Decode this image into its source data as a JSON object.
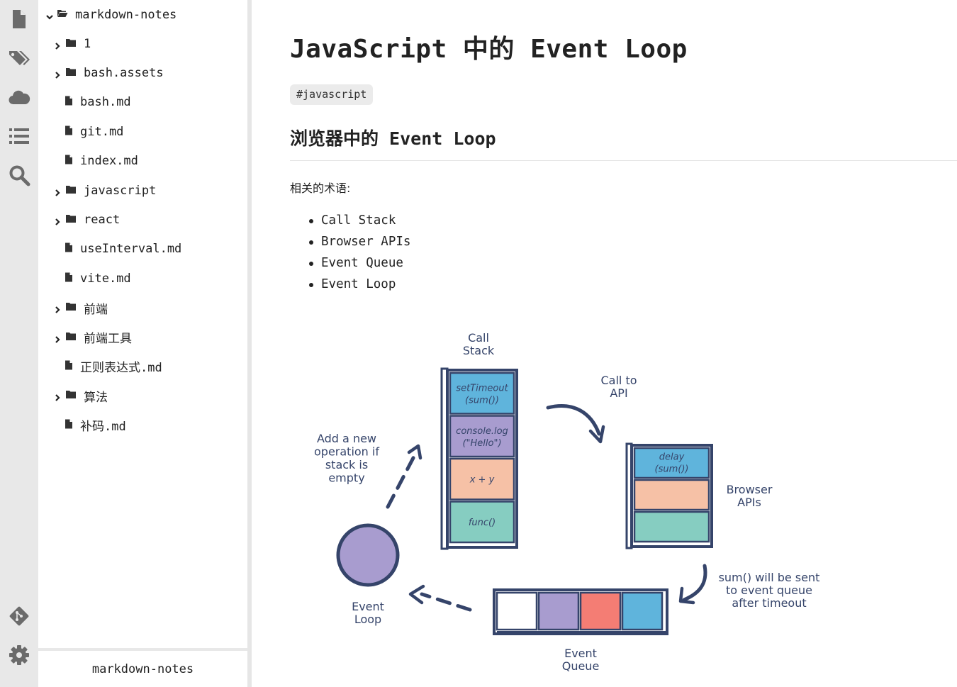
{
  "activity_bar": {
    "items": [
      {
        "name": "file-icon"
      },
      {
        "name": "tags-icon"
      },
      {
        "name": "cloud-icon"
      },
      {
        "name": "list-icon"
      },
      {
        "name": "search-icon"
      },
      {
        "name": "git-icon"
      },
      {
        "name": "gear-icon"
      }
    ]
  },
  "sidebar": {
    "root": "markdown-notes",
    "items": [
      {
        "label": "1",
        "type": "folder"
      },
      {
        "label": "bash.assets",
        "type": "folder"
      },
      {
        "label": "bash.md",
        "type": "file"
      },
      {
        "label": "git.md",
        "type": "file"
      },
      {
        "label": "index.md",
        "type": "file"
      },
      {
        "label": "javascript",
        "type": "folder"
      },
      {
        "label": "react",
        "type": "folder"
      },
      {
        "label": "useInterval.md",
        "type": "file"
      },
      {
        "label": "vite.md",
        "type": "file"
      },
      {
        "label": "前端",
        "type": "folder"
      },
      {
        "label": "前端工具",
        "type": "folder"
      },
      {
        "label": "正则表达式.md",
        "type": "file"
      },
      {
        "label": "算法",
        "type": "folder"
      },
      {
        "label": "补码.md",
        "type": "file"
      }
    ],
    "footer": "markdown-notes"
  },
  "document": {
    "title": "JavaScript 中的 Event Loop",
    "tag": "#javascript",
    "heading": "浏览器中的 Event Loop",
    "paragraph": "相关的术语:",
    "terms": [
      "Call Stack",
      "Browser APIs",
      "Event Queue",
      "Event Loop"
    ]
  },
  "diagram": {
    "call_stack_label": [
      "Call",
      "Stack"
    ],
    "call_stack_items": [
      {
        "lines": [
          "setTimeout",
          "(sum())"
        ],
        "color": "#5fb4dc"
      },
      {
        "lines": [
          "console.log",
          "(\"Hello\")"
        ],
        "color": "#a89ccf"
      },
      {
        "lines": [
          "x + y"
        ],
        "color": "#f6c1a6"
      },
      {
        "lines": [
          "func()"
        ],
        "color": "#86cdc1"
      }
    ],
    "call_to_api": [
      "Call to",
      "API"
    ],
    "browser_apis_label": [
      "Browser",
      "APIs"
    ],
    "browser_api_items": [
      {
        "lines": [
          "delay",
          "(sum())"
        ],
        "color": "#5fb4dc"
      },
      {
        "lines": [],
        "color": "#f6c1a6"
      },
      {
        "lines": [],
        "color": "#86cdc1"
      }
    ],
    "sum_note": [
      "sum() will be sent",
      "to event queue",
      "after timeout"
    ],
    "queue_label": [
      "Event",
      "Queue"
    ],
    "queue_colors": [
      "#ffffff",
      "#a89ccf",
      "#f47d74",
      "#5fb4dc"
    ],
    "loop_label": [
      "Event",
      "Loop"
    ],
    "loop_color": "#a89ccf",
    "add_note": [
      "Add a new",
      "operation if",
      "stack is",
      "empty"
    ],
    "ink": "#35446a"
  }
}
